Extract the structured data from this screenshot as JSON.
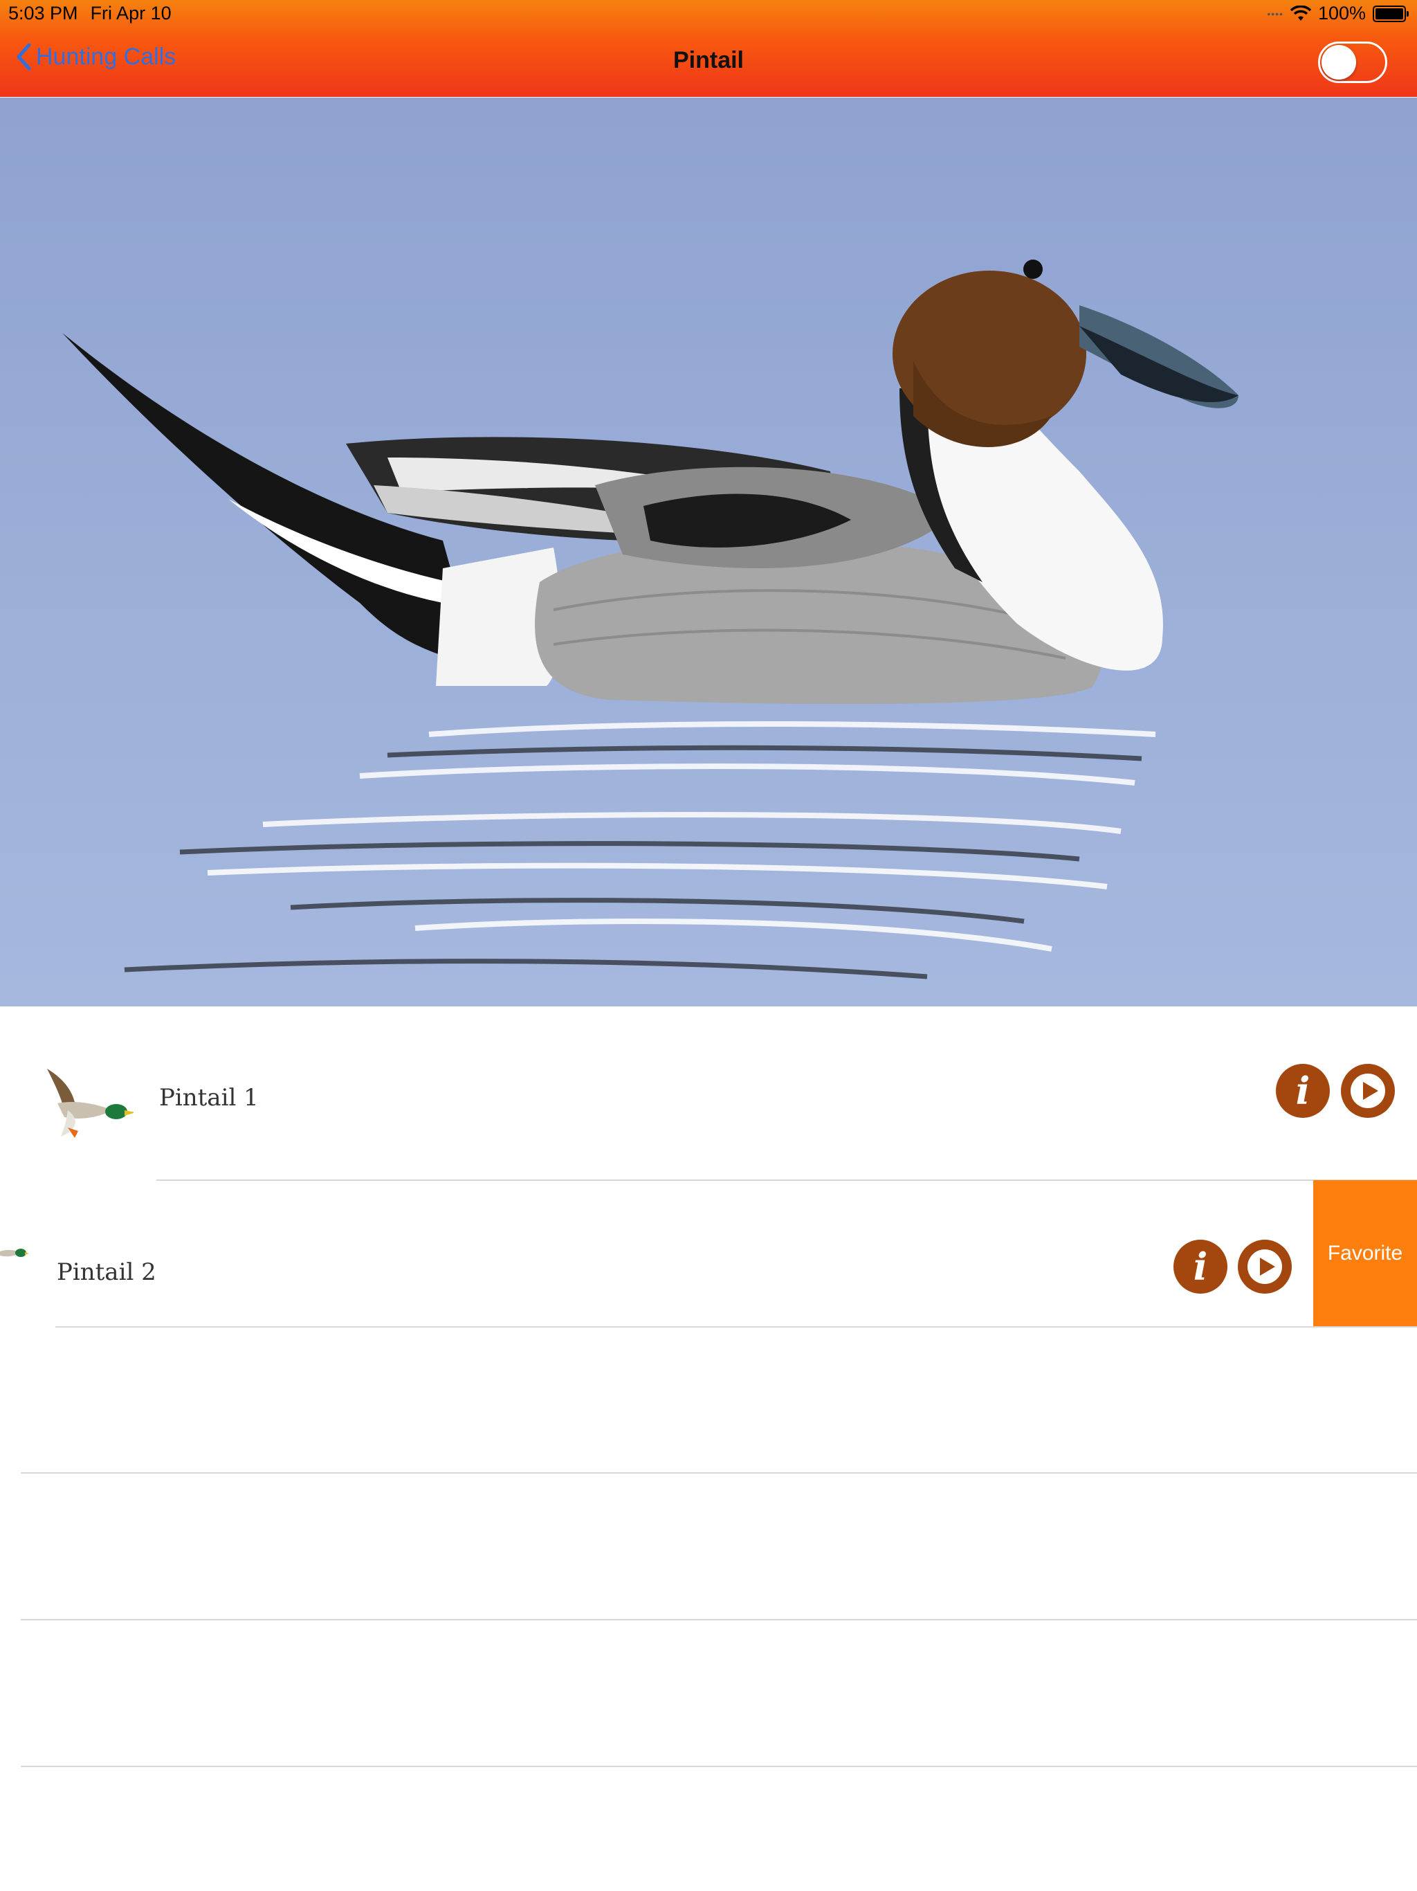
{
  "status_bar": {
    "time": "5:03 PM",
    "date": "Fri Apr 10",
    "battery": "100%"
  },
  "nav": {
    "back_label": "Hunting Calls",
    "title": "Pintail",
    "toggle_on": false
  },
  "calls": [
    {
      "label": "Pintail 1"
    },
    {
      "label": "Pintail 2"
    }
  ],
  "actions": {
    "favorite_label": "Favorite"
  },
  "colors": {
    "header_top": "#f5820f",
    "header_bottom": "#f0361a",
    "button_brown": "#a3470e",
    "favorite_orange": "#ff7f0e",
    "link_blue": "#2f6fe0"
  }
}
